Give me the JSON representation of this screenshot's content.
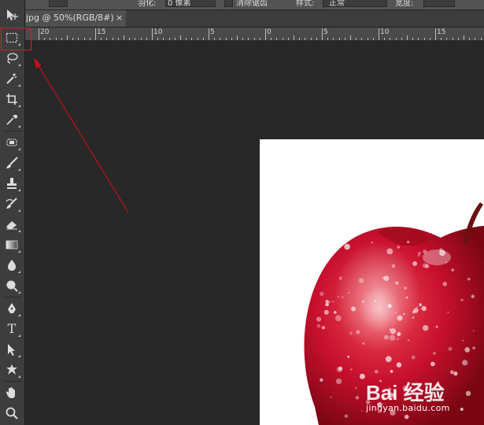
{
  "options_bar": {
    "feather_label": "羽化:",
    "feather_value": "0 像素",
    "antialias_label": "消除锯齿",
    "style_label": "样式:",
    "style_value": "正常",
    "width_label": "宽度:"
  },
  "document_tab": {
    "title": "jpg @ 50%(RGB/8#)",
    "close_glyph": "×"
  },
  "ruler": {
    "labels": [
      "20",
      "15",
      "10",
      "5",
      "0",
      "5",
      "10",
      "15"
    ]
  },
  "toolbar": {
    "tools": [
      {
        "name": "move-tool",
        "icon": "move-icon"
      },
      {
        "name": "rectangular-marquee-tool",
        "icon": "marquee-icon",
        "selected": true
      },
      {
        "name": "lasso-tool",
        "icon": "lasso-icon"
      },
      {
        "name": "magic-wand-tool",
        "icon": "magic-wand-icon"
      },
      {
        "name": "crop-tool",
        "icon": "crop-icon"
      },
      {
        "name": "eyedropper-tool",
        "icon": "eyedropper-icon"
      },
      {
        "name": "healing-brush-tool",
        "icon": "healing-brush-icon"
      },
      {
        "name": "brush-tool",
        "icon": "brush-icon"
      },
      {
        "name": "clone-stamp-tool",
        "icon": "stamp-icon"
      },
      {
        "name": "history-brush-tool",
        "icon": "history-brush-icon"
      },
      {
        "name": "eraser-tool",
        "icon": "eraser-icon"
      },
      {
        "name": "gradient-tool",
        "icon": "gradient-icon"
      },
      {
        "name": "blur-tool",
        "icon": "blur-icon"
      },
      {
        "name": "dodge-tool",
        "icon": "dodge-icon"
      },
      {
        "name": "pen-tool",
        "icon": "pen-icon"
      },
      {
        "name": "type-tool",
        "icon": "type-icon",
        "glyph": "T"
      },
      {
        "name": "path-selection-tool",
        "icon": "path-selection-icon"
      },
      {
        "name": "custom-shape-tool",
        "icon": "custom-shape-icon"
      },
      {
        "name": "hand-tool",
        "icon": "hand-icon"
      },
      {
        "name": "zoom-tool",
        "icon": "zoom-icon"
      }
    ]
  },
  "annotation": {
    "color": "#c0101a"
  },
  "watermark": {
    "brand": "Bai 经验",
    "url": "jingyan.baidu.com"
  },
  "colors": {
    "workspace": "#282828",
    "toolbar": "#3d3d3d",
    "ruler": "#4a4a4a",
    "apple_red": "#c8102e"
  }
}
